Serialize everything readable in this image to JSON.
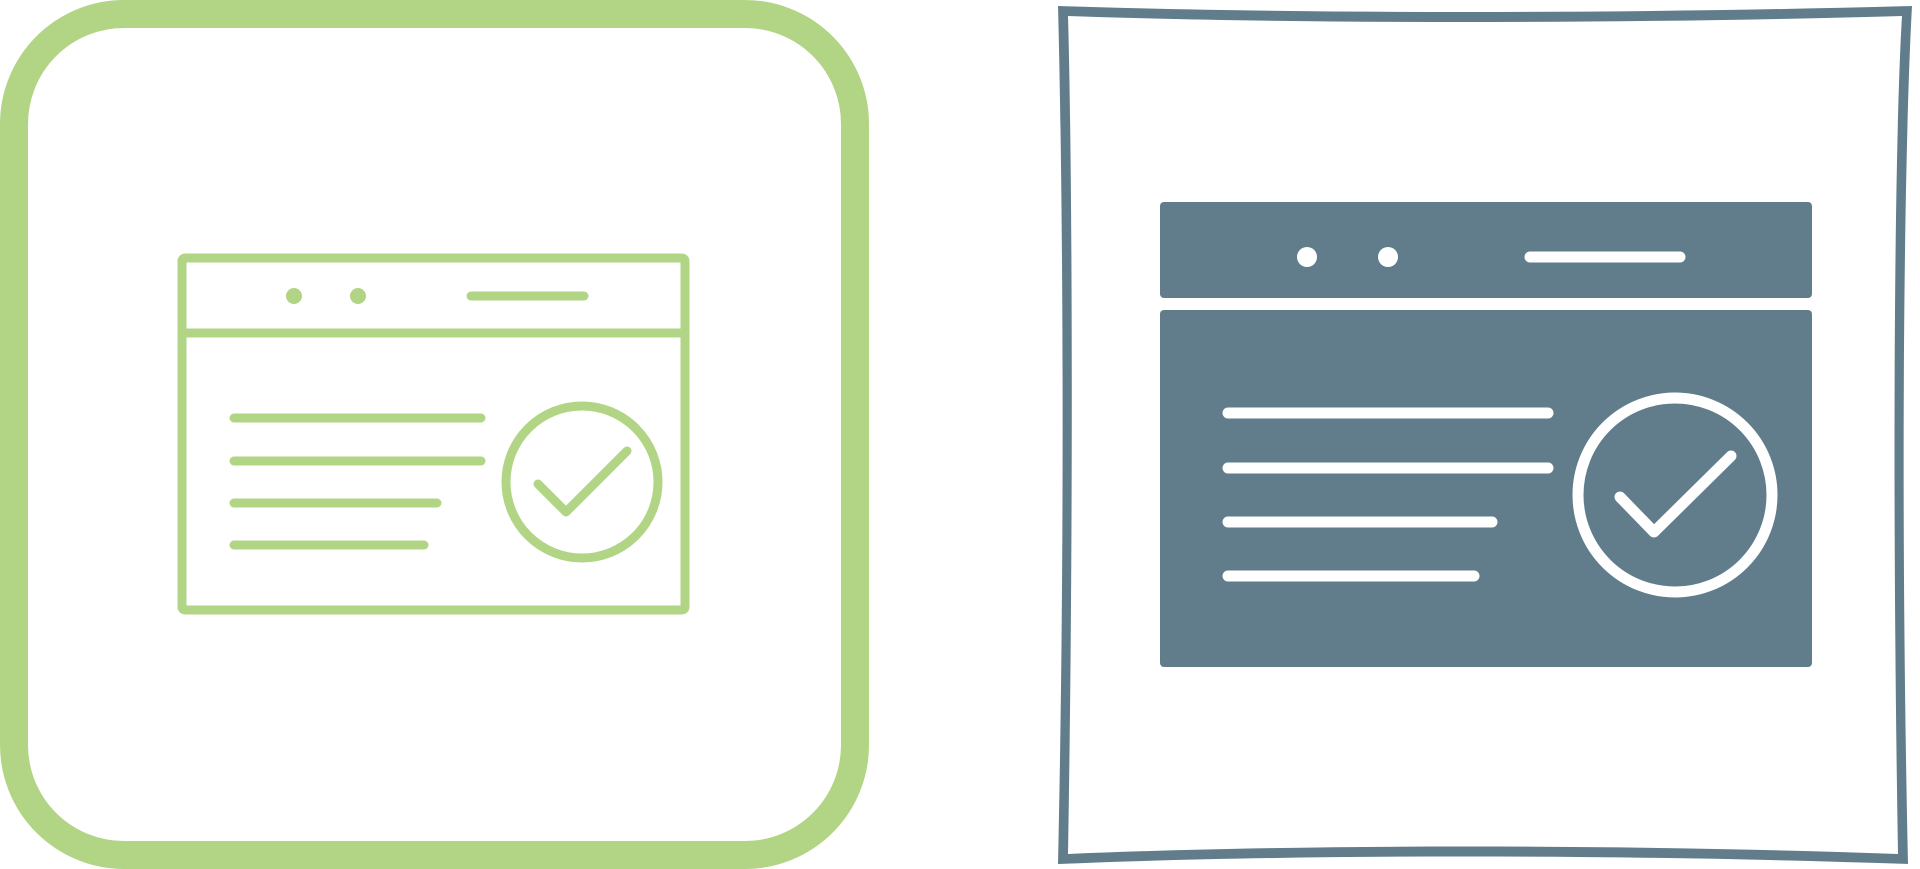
{
  "icons": [
    {
      "name": "webpage-check-outline-icon",
      "style": "line",
      "frame_shape": "rounded-square",
      "color": "#b1d585"
    },
    {
      "name": "webpage-check-glyph-icon",
      "style": "glyph",
      "frame_shape": "hand-drawn-square",
      "color": "#617d8c",
      "frame_color": "#617d8c"
    }
  ],
  "colors": {
    "background": "#ffffff",
    "green": "#b1d585",
    "slate": "#617d8c"
  }
}
